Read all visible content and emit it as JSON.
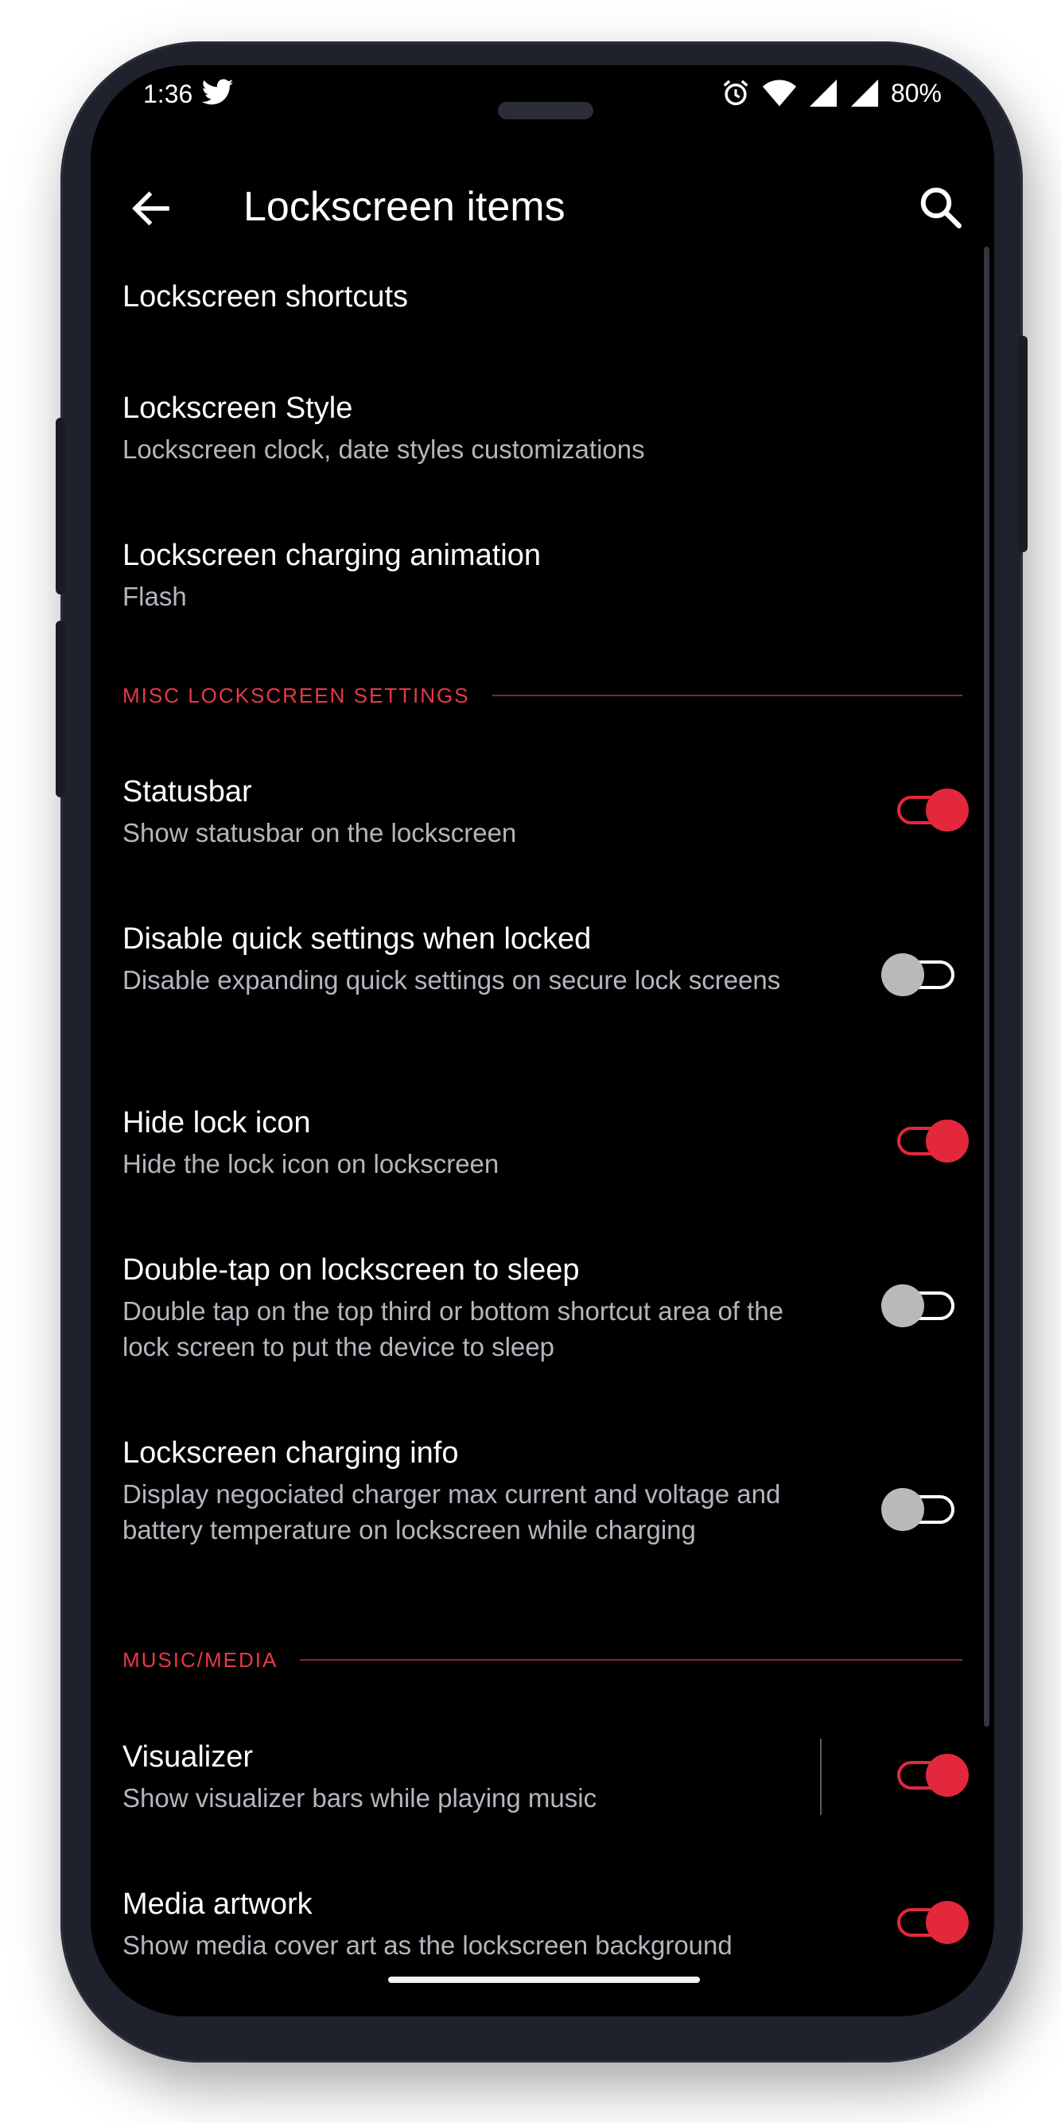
{
  "status_bar": {
    "time": "1:36",
    "battery": "80%",
    "icons": [
      "twitter-icon",
      "alarm-icon",
      "wifi-icon",
      "signal-icon",
      "signal-icon"
    ]
  },
  "app_bar": {
    "title": "Lockscreen items",
    "back_icon": "arrow-back-icon",
    "search_icon": "search-icon"
  },
  "items": [
    {
      "title": "Lockscreen shortcuts",
      "subtitle": ""
    },
    {
      "title": "Lockscreen Style",
      "subtitle": "Lockscreen clock, date styles customizations"
    },
    {
      "title": "Lockscreen charging animation",
      "subtitle": "Flash"
    }
  ],
  "sections": [
    {
      "header": "MISC LOCKSCREEN SETTINGS",
      "items": [
        {
          "title": "Statusbar",
          "subtitle": "Show statusbar on the lockscreen",
          "enabled": true
        },
        {
          "title": "Disable quick settings when locked",
          "subtitle": "Disable expanding quick settings on secure lock screens",
          "enabled": false
        },
        {
          "title": "Hide lock icon",
          "subtitle": "Hide the lock icon on lockscreen",
          "enabled": true
        },
        {
          "title": "Double-tap on lockscreen to sleep",
          "subtitle": "Double tap on the top third or bottom shortcut area of the lock screen to put the device to sleep",
          "enabled": false
        },
        {
          "title": "Lockscreen charging info",
          "subtitle": "Display negociated charger max current and voltage and battery temperature on lockscreen while charging",
          "enabled": false
        }
      ]
    },
    {
      "header": "MUSIC/MEDIA",
      "items": [
        {
          "title": "Visualizer",
          "subtitle": "Show visualizer bars while playing music",
          "enabled": true
        },
        {
          "title": "Media artwork",
          "subtitle": "Show media cover art as the lockscreen background",
          "enabled": true
        }
      ]
    }
  ],
  "colors": {
    "accent": "#e3283c",
    "background": "#000000",
    "frame": "#1f222c",
    "secondary_text": "#b3b6bd"
  }
}
